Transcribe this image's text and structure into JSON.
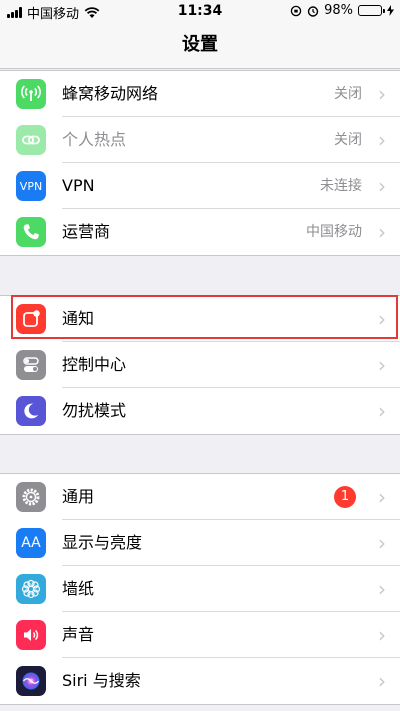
{
  "status": {
    "carrier": "中国移动",
    "time": "11:34",
    "battery_pct": "98%",
    "battery_level": 0.98
  },
  "nav": {
    "title": "设置"
  },
  "group1": [
    {
      "label": "蜂窝移动网络",
      "value": "关闭",
      "icon": "cellular-antenna-icon",
      "color": "#4cd964",
      "dim": false
    },
    {
      "label": "个人热点",
      "value": "关闭",
      "icon": "link-icon",
      "color": "#4cd964",
      "dim": true
    },
    {
      "label": "VPN",
      "value": "未连接",
      "icon": "vpn-icon",
      "color": "#1a7cf4",
      "icon_text": "VPN",
      "dim": false
    },
    {
      "label": "运营商",
      "value": "中国移动",
      "icon": "phone-icon",
      "color": "#4cd964",
      "dim": false
    }
  ],
  "group2": [
    {
      "label": "通知",
      "icon": "notifications-icon",
      "color": "#ff3b30"
    },
    {
      "label": "控制中心",
      "icon": "toggles-icon",
      "color": "#8e8e93"
    },
    {
      "label": "勿扰模式",
      "icon": "moon-icon",
      "color": "#5856d6"
    }
  ],
  "group3": [
    {
      "label": "通用",
      "icon": "gear-icon",
      "color": "#8e8e93",
      "badge": "1"
    },
    {
      "label": "显示与亮度",
      "icon": "text-size-icon",
      "color": "#1a7cf4",
      "icon_text": "AA"
    },
    {
      "label": "墙纸",
      "icon": "flower-icon",
      "color": "#34aadc"
    },
    {
      "label": "声音",
      "icon": "speaker-icon",
      "color": "#ff2d55"
    },
    {
      "label": "Siri 与搜索",
      "icon": "siri-icon",
      "color": "#1c1c3a"
    }
  ]
}
